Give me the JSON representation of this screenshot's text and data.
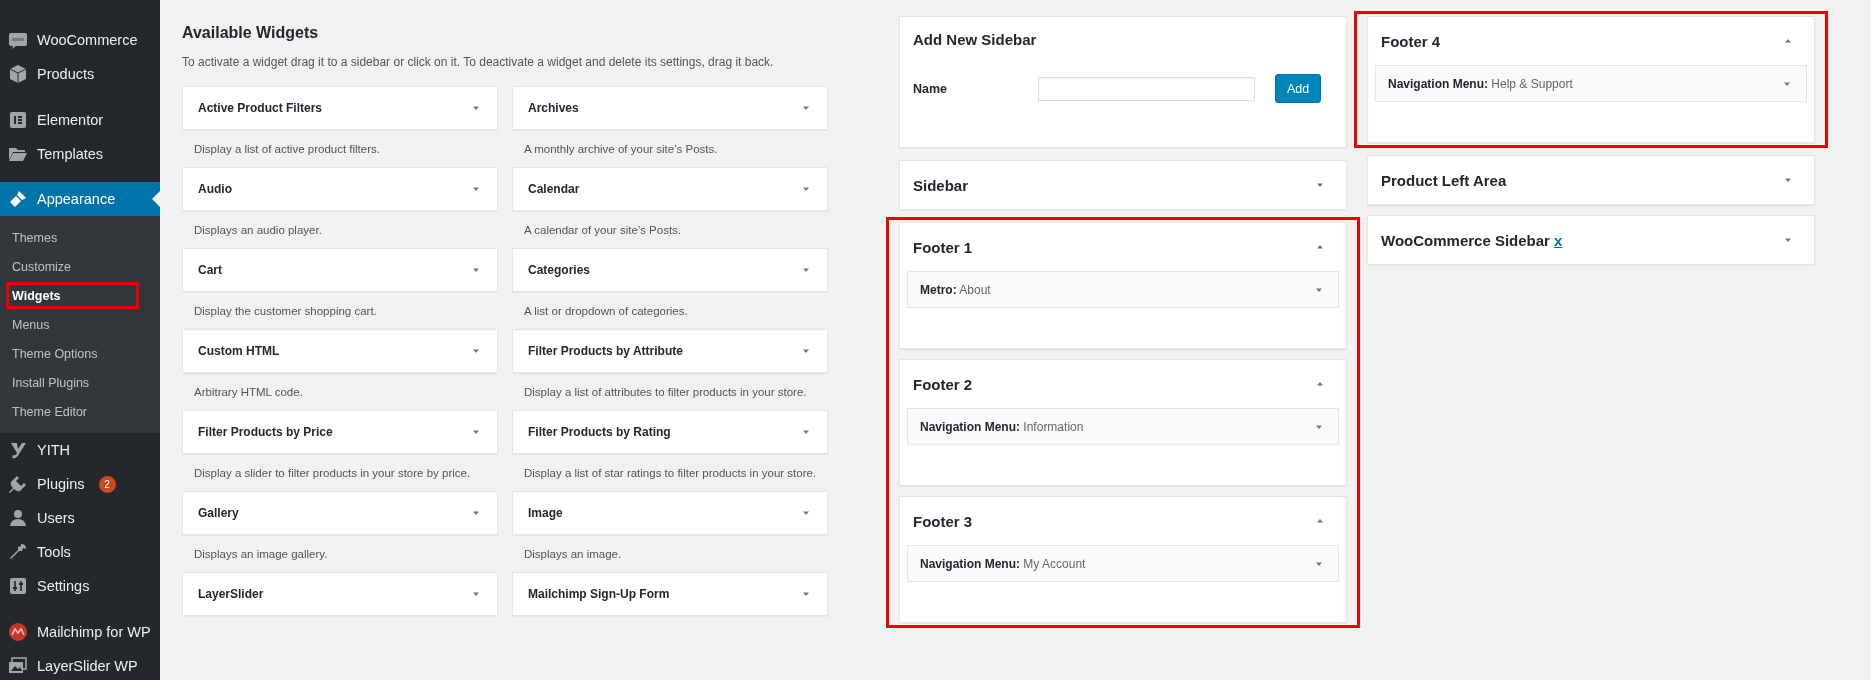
{
  "admin_menu": {
    "groups": [
      {
        "items": [
          {
            "label": "WooCommerce",
            "selected": false
          },
          {
            "label": "Products",
            "selected": false
          }
        ]
      },
      {
        "items": [
          {
            "label": "Elementor",
            "selected": false
          },
          {
            "label": "Templates",
            "selected": false
          },
          {
            "label": "Appearance",
            "selected": true,
            "children": [
              {
                "label": "Themes",
                "selected": false,
                "highlighted": false
              },
              {
                "label": "Customize",
                "selected": false,
                "highlighted": false
              },
              {
                "label": "Widgets",
                "selected": true,
                "highlighted": true
              },
              {
                "label": "Menus",
                "selected": false,
                "highlighted": false
              },
              {
                "label": "Theme Options",
                "selected": false,
                "highlighted": false
              },
              {
                "label": "Install Plugins",
                "selected": false,
                "highlighted": false
              },
              {
                "label": "Theme Editor",
                "selected": false,
                "highlighted": false
              }
            ]
          },
          {
            "label": "YITH",
            "selected": false
          },
          {
            "label": "Plugins",
            "selected": false,
            "badge": "2"
          },
          {
            "label": "Users",
            "selected": false
          },
          {
            "label": "Tools",
            "selected": false
          },
          {
            "label": "Settings",
            "selected": false
          }
        ]
      },
      {
        "items": [
          {
            "label": "Mailchimp for WP",
            "selected": false
          },
          {
            "label": "LayerSlider WP",
            "selected": false
          }
        ]
      }
    ]
  },
  "available_widgets": {
    "title": "Available Widgets",
    "description": "To activate a widget drag it to a sidebar or click on it. To deactivate a widget and delete its settings, drag it back.",
    "widgets": [
      {
        "name": "Active Product Filters",
        "description": "Display a list of active product filters."
      },
      {
        "name": "Archives",
        "description": "A monthly archive of your site’s Posts."
      },
      {
        "name": "Audio",
        "description": "Displays an audio player."
      },
      {
        "name": "Calendar",
        "description": "A calendar of your site’s Posts."
      },
      {
        "name": "Cart",
        "description": "Display the customer shopping cart."
      },
      {
        "name": "Categories",
        "description": "A list or dropdown of categories."
      },
      {
        "name": "Custom HTML",
        "description": "Arbitrary HTML code."
      },
      {
        "name": "Filter Products by Attribute",
        "description": "Display a list of attributes to filter products in your store."
      },
      {
        "name": "Filter Products by Price",
        "description": "Display a slider to filter products in your store by price."
      },
      {
        "name": "Filter Products by Rating",
        "description": "Display a list of star ratings to filter products in your store."
      },
      {
        "name": "Gallery",
        "description": "Displays an image gallery."
      },
      {
        "name": "Image",
        "description": "Displays an image."
      },
      {
        "name": "LayerSlider"
      },
      {
        "name": "Mailchimp Sign-Up Form"
      }
    ]
  },
  "sidebar_columns": [
    {
      "add_sidebar": {
        "title": "Add New Sidebar",
        "name_label": "Name",
        "button": "Add"
      },
      "groups": [
        {
          "highlighted": false,
          "sidebars": [
            {
              "title": "Sidebar",
              "expanded": false
            }
          ]
        },
        {
          "highlighted": true,
          "sidebars": [
            {
              "title": "Footer 1",
              "expanded": true,
              "widgets": [
                {
                  "name": "Metro:",
                  "title": "About"
                }
              ]
            },
            {
              "title": "Footer 2",
              "expanded": true,
              "widgets": [
                {
                  "name": "Navigation Menu:",
                  "title": "Information"
                }
              ]
            },
            {
              "title": "Footer 3",
              "expanded": true,
              "widgets": [
                {
                  "name": "Navigation Menu:",
                  "title": "My Account"
                }
              ]
            }
          ]
        }
      ]
    },
    {
      "groups": [
        {
          "highlighted": true,
          "sidebars": [
            {
              "title": "Footer 4",
              "expanded": true,
              "widgets": [
                {
                  "name": "Navigation Menu:",
                  "title": "Help & Support"
                }
              ]
            }
          ]
        },
        {
          "highlighted": false,
          "sidebars": [
            {
              "title": "Product Left Area",
              "expanded": false
            },
            {
              "title": "WooCommerce Sidebar",
              "expanded": false,
              "link": "x"
            }
          ]
        }
      ]
    }
  ]
}
